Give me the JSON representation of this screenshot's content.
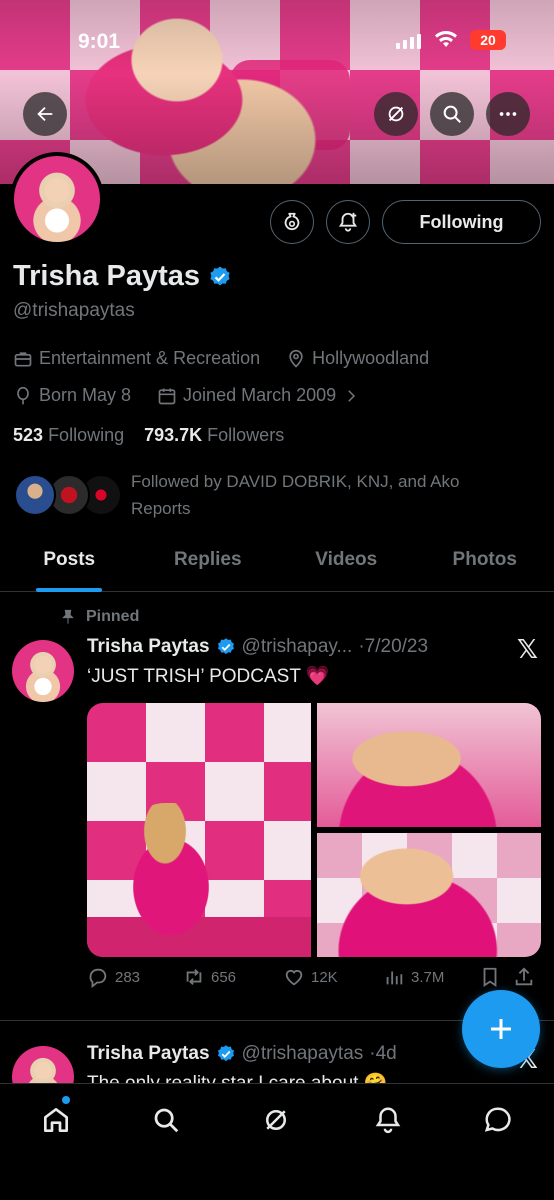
{
  "status_bar": {
    "time": "9:01",
    "battery": "20"
  },
  "profile": {
    "name": "Trisha Paytas",
    "handle": "@trishapaytas",
    "category": "Entertainment & Recreation",
    "location": "Hollywoodland",
    "born": "Born May 8",
    "joined": "Joined March 2009",
    "following_count": "523",
    "following_label": "Following",
    "followers_count": "793.7K",
    "followers_label": "Followers",
    "followed_by": "Followed by DAVID DOBRIK, KNJ, and Ako Reports",
    "follow_button_label": "Following"
  },
  "tabs": [
    {
      "label": "Posts",
      "active": true
    },
    {
      "label": "Replies",
      "active": false
    },
    {
      "label": "Videos",
      "active": false
    },
    {
      "label": "Photos",
      "active": false
    }
  ],
  "posts": [
    {
      "pinned_label": "Pinned",
      "name": "Trisha Paytas",
      "handle": "@trishapay...",
      "date": "·7/20/23",
      "text": "‘JUST TRISH’ PODCAST",
      "emoji": "💗",
      "replies": "283",
      "reposts": "656",
      "likes": "12K",
      "views": "3.7M"
    },
    {
      "name": "Trisha Paytas",
      "handle": "@trishapaytas",
      "date": "·4d",
      "text": "The only reality star I care about 🤗"
    }
  ],
  "colors": {
    "accent": "#1d9bf0",
    "background": "#000000",
    "text_primary": "#e7e9ea",
    "text_secondary": "#71767b",
    "border": "#2f3336",
    "battery": "#ff3b30"
  },
  "icons": {
    "back": "arrow-left-icon",
    "grok": "grok-icon",
    "search": "search-icon",
    "more": "more-horizontal-icon",
    "verified": "verified-badge-icon",
    "briefcase": "briefcase-icon",
    "location": "location-pin-icon",
    "balloon": "birthday-balloon-icon",
    "calendar": "calendar-icon",
    "chevron": "chevron-right-icon",
    "pin": "pin-icon",
    "reply": "reply-icon",
    "repost": "repost-icon",
    "like": "heart-icon",
    "views": "views-icon",
    "bookmark": "bookmark-icon",
    "share": "share-icon",
    "compose": "plus-icon",
    "home": "home-icon",
    "notifications": "bell-icon",
    "messages": "message-icon"
  }
}
